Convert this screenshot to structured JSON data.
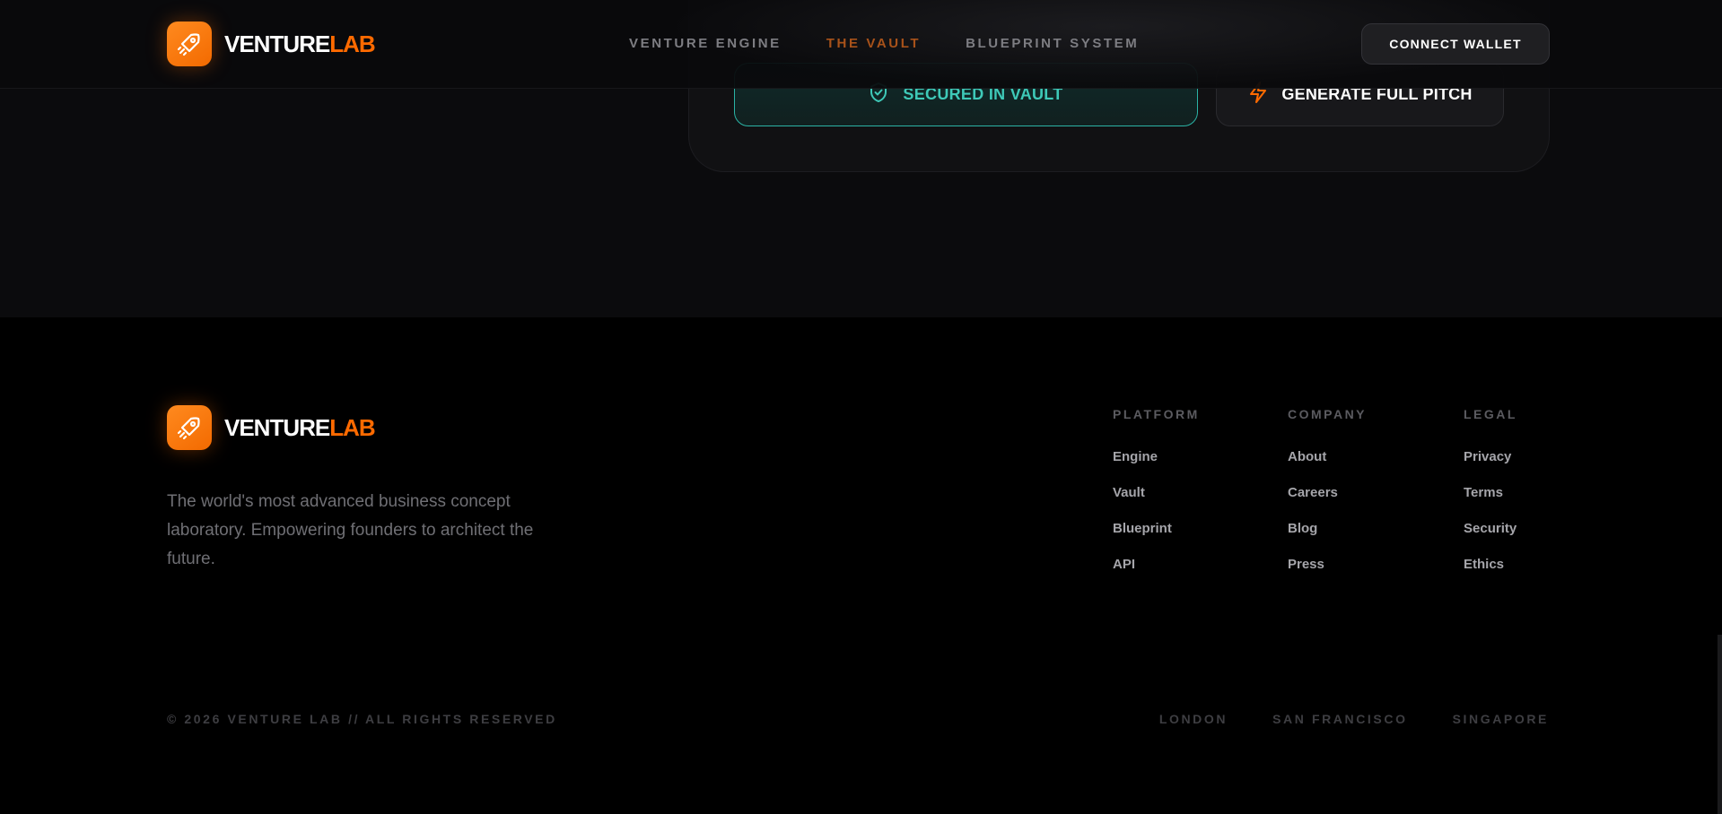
{
  "brand": {
    "name_white": "VENTURE",
    "name_orange": "LAB",
    "logo_icon": "rocket-icon"
  },
  "nav": {
    "items": [
      {
        "label": "VENTURE ENGINE",
        "active": false
      },
      {
        "label": "THE VAULT",
        "active": true
      },
      {
        "label": "BLUEPRINT SYSTEM",
        "active": false
      }
    ],
    "connect_label": "CONNECT WALLET"
  },
  "vault_card": {
    "secured_label": "SECURED IN VAULT",
    "secured_icon": "shield-check-icon",
    "pitch_label": "GENERATE FULL PITCH",
    "pitch_icon": "lightning-icon"
  },
  "footer": {
    "tagline": "The world's most advanced business concept laboratory. Empowering founders to architect the future.",
    "columns": [
      {
        "title": "PLATFORM",
        "links": [
          "Engine",
          "Vault",
          "Blueprint",
          "API"
        ]
      },
      {
        "title": "COMPANY",
        "links": [
          "About",
          "Careers",
          "Blog",
          "Press"
        ]
      },
      {
        "title": "LEGAL",
        "links": [
          "Privacy",
          "Terms",
          "Security",
          "Ethics"
        ]
      }
    ],
    "copyright": "© 2026 VENTURE LAB // ALL RIGHTS RESERVED",
    "cities": [
      "LONDON",
      "SAN FRANCISCO",
      "SINGAPORE"
    ]
  },
  "colors": {
    "accent": "#ff6a00",
    "teal": "#3ec9b8",
    "background": "#000000"
  }
}
